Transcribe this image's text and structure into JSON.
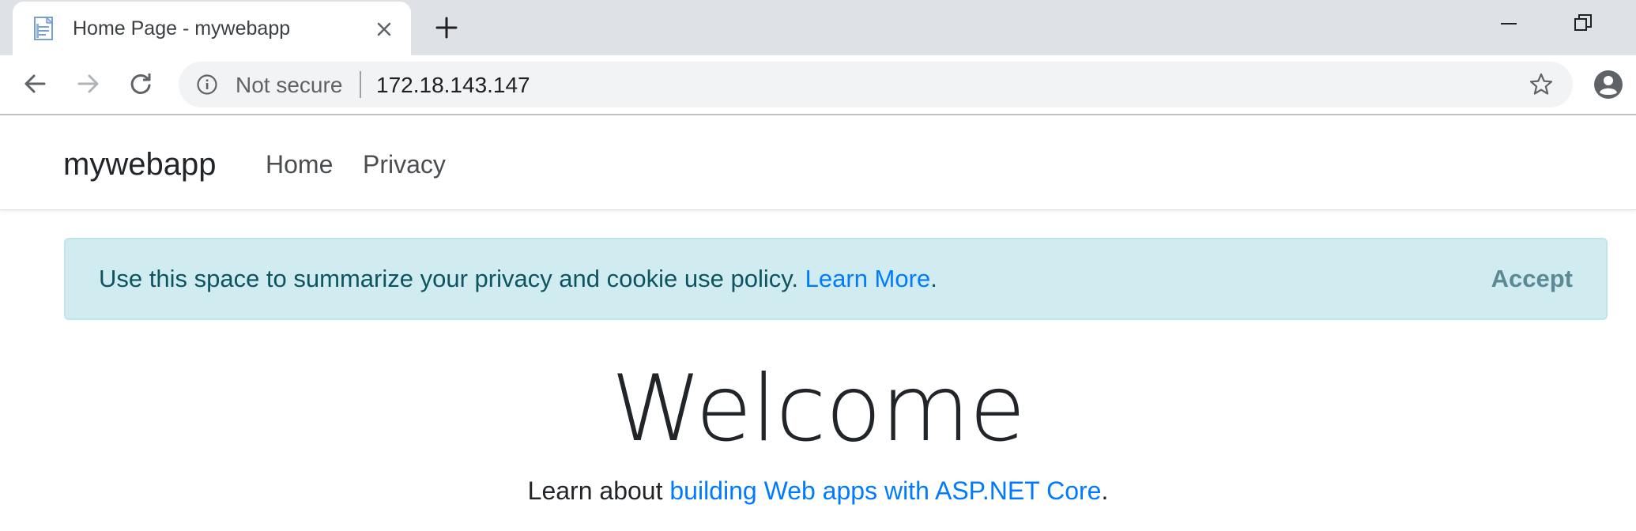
{
  "browser": {
    "tab": {
      "title": "Home Page - mywebapp",
      "favicon": "document-icon",
      "close_icon": "close-icon"
    },
    "new_tab_icon": "plus-icon",
    "window_controls": [
      "minimize-icon",
      "restore-icon"
    ],
    "toolbar": {
      "back_icon": "back-arrow-icon",
      "forward_icon": "forward-arrow-icon",
      "reload_icon": "reload-icon",
      "security_label": "Not secure",
      "url": "172.18.143.147",
      "bookmark_icon": "star-icon",
      "profile_icon": "profile-icon"
    }
  },
  "site": {
    "navbar": {
      "brand": "mywebapp",
      "links": [
        {
          "label": "Home"
        },
        {
          "label": "Privacy"
        }
      ]
    },
    "cookie_alert": {
      "text": "Use this space to summarize your privacy and cookie use policy.",
      "link": "Learn More",
      "link_suffix": ".",
      "accept_label": "Accept"
    },
    "hero": {
      "heading": "Welcome",
      "text_prefix": "Learn about ",
      "link": "building Web apps with ASP.NET Core",
      "text_suffix": "."
    }
  },
  "colors": {
    "tabstrip_bg": "#dee1e6",
    "alert_bg": "#d1ecf1",
    "alert_text": "#0c5460",
    "link": "#007bff"
  }
}
